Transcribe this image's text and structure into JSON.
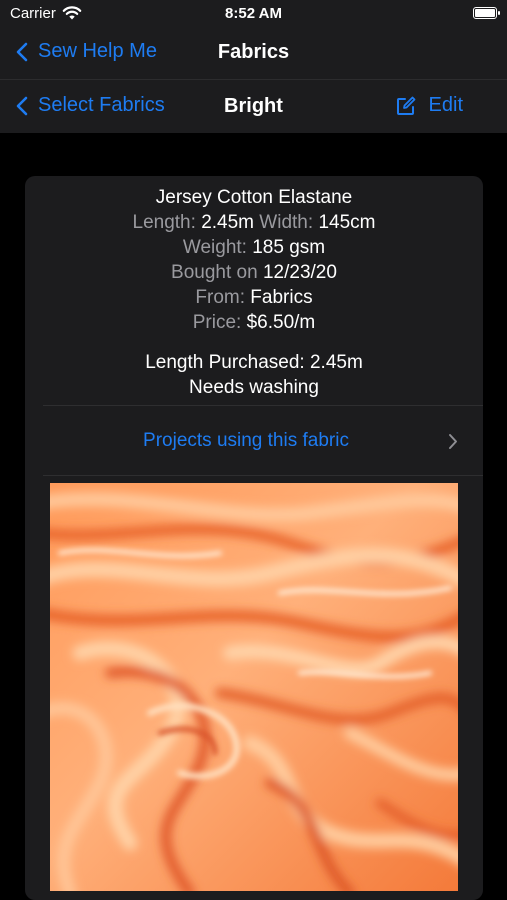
{
  "status_bar": {
    "carrier": "Carrier",
    "time": "8:52 AM"
  },
  "nav_primary": {
    "back_label": "Sew Help Me",
    "title": "Fabrics"
  },
  "nav_secondary": {
    "back_label": "Select Fabrics",
    "title": "Bright",
    "edit_label": "Edit"
  },
  "fabric": {
    "name_line": "Jersey  Cotton Elastane",
    "length_label": "Length:",
    "length_value": "2.45m",
    "width_label": "Width:",
    "width_value": "145cm",
    "weight_label": "Weight:",
    "weight_value": "185 gsm",
    "bought_label": "Bought on",
    "bought_value": "12/23/20",
    "from_label": "From:",
    "from_value": "Fabrics",
    "price_label": "Price:",
    "price_value": "$6.50/m",
    "length_purchased": "Length Purchased: 2.45m",
    "care_note": "Needs washing"
  },
  "projects_link": {
    "label": "Projects using this fabric"
  },
  "colors": {
    "accent": "#1e7cf2",
    "background": "#000000",
    "bar": "#1c1c1e",
    "card": "#1c1c1e",
    "secondary_text": "#9a9a9f",
    "fabric": "#ff9a5c"
  },
  "icons": [
    "wifi-icon",
    "battery-icon",
    "chevron-left-icon",
    "edit-icon",
    "chevron-right-icon"
  ]
}
